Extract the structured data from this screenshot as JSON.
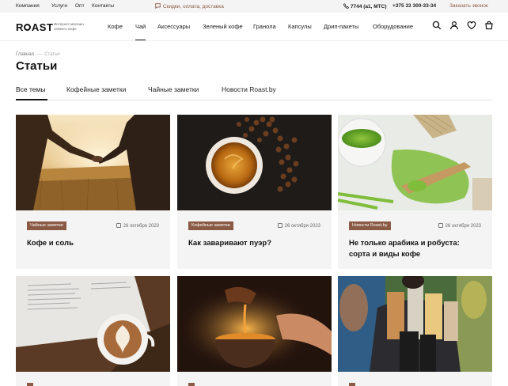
{
  "topbar": {
    "links": [
      "Компания",
      "Услуги",
      "Опт",
      "Контакты"
    ],
    "promo": "Скидки, оплата, доставка",
    "phone1": "7744 (a1, МТС)",
    "phone2": "+375 33 300-33-34",
    "callback": "Заказать звонок"
  },
  "header": {
    "logo": "ROAST",
    "tagline": "Интернет-магазин свежего кофе",
    "nav": [
      "Кофе",
      "Чай",
      "Аксессуары",
      "Зеленый кофе",
      "Гранола",
      "Капсулы",
      "Дрип-пакеты",
      "Оборудование"
    ],
    "active_nav": "Чай"
  },
  "breadcrumb": {
    "home": "Главная",
    "sep": "—",
    "current": "Статьи"
  },
  "page_title": "Статьи",
  "tabs": [
    "Все темы",
    "Кофейные заметки",
    "Чайные заметки",
    "Новости Roast.by"
  ],
  "active_tab": "Все темы",
  "accent": "#8a5a44",
  "cards": [
    {
      "badge": "Чайные заметки",
      "date": "26 октября 2023",
      "title": "Кофе и соль"
    },
    {
      "badge": "Кофейные заметки",
      "date": "26 октября 2023",
      "title": "Как заваривают пуэр?"
    },
    {
      "badge": "Новости Roast.by",
      "date": "26 октября 2023",
      "title": "Не только арабика и робуста: сорта и виды кофе"
    },
    {
      "badge": "",
      "date": "",
      "title": ""
    },
    {
      "badge": "",
      "date": "",
      "title": ""
    },
    {
      "badge": "",
      "date": "",
      "title": ""
    }
  ]
}
